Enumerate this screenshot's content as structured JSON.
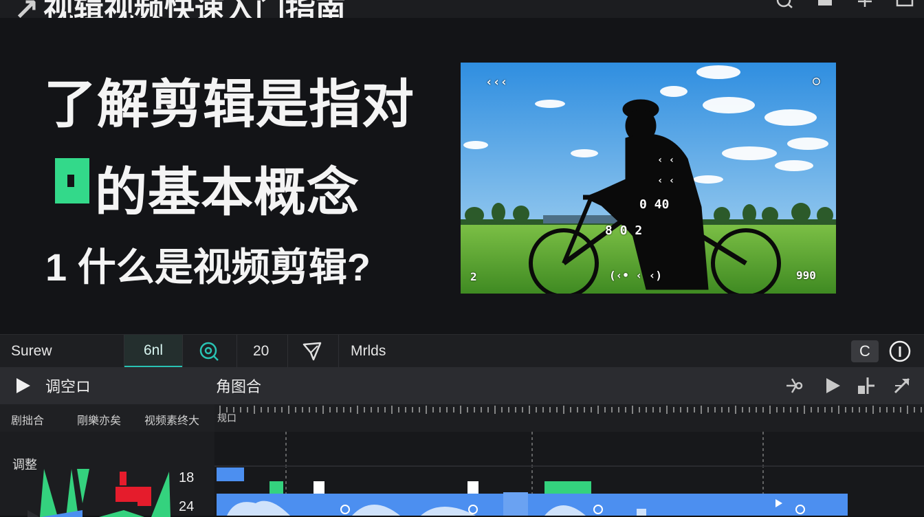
{
  "window": {
    "title": "视辑视频快速入门指南",
    "title_prefix": "↗"
  },
  "slide": {
    "line1": "了解剪辑是指对",
    "line2": "的基本概念",
    "line3": "1  什么是视频剪辑?",
    "accent_color": "#33d98a"
  },
  "photo_overlay": {
    "top_left": "‹‹‹",
    "top_right": "○",
    "mid1": "‹ ‹",
    "mid2": "‹ ‹",
    "mid3": "0 40",
    "mid4": "8   0 2",
    "bottom_left": "2",
    "bottom_center": "(‹• ‹ ‹)",
    "bottom_right": "990"
  },
  "toolbar": {
    "item1": "Surew",
    "item2": "6nl",
    "item3_icon": "search-zoom-icon",
    "item4": "20",
    "item5_icon": "pen-icon",
    "item6": "Mrlds",
    "right_btn1": "C",
    "right_btn2_icon": "info-icon",
    "accent": "#29c3b4"
  },
  "playrow": {
    "play_icon": "play-icon",
    "label_left": "调空ロ",
    "label_center": "角图合",
    "icons": [
      "split-icon",
      "play-icon",
      "trim-icon",
      "expand-icon"
    ]
  },
  "subrow": {
    "items": [
      "剧拙合",
      "剛樂亦矣",
      "视频素终大"
    ],
    "ruler_label": "规口"
  },
  "left_panel": {
    "title": "调整",
    "value1": "18",
    "value2": "24"
  },
  "colors": {
    "clip_blue": "#4c8ff0",
    "clip_green": "#34d27e",
    "marker_red": "#e51c2c"
  }
}
